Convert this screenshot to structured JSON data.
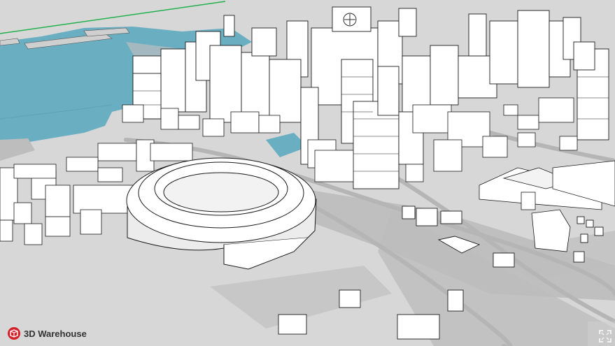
{
  "viewer": {
    "brand_label": "3D Warehouse",
    "brand_icon": "3d-warehouse-logo-icon",
    "fullscreen_icon": "fullscreen-expand-icon"
  },
  "colors": {
    "ground": "#d7d7d7",
    "water": "#6aaec2",
    "building": "#ffffff",
    "building_shade": "#e9e9e9",
    "edge": "#1a1a1a",
    "shadow": "#bdbdbd",
    "horizon_line": "#22b14c",
    "brand_red": "#d42027"
  }
}
